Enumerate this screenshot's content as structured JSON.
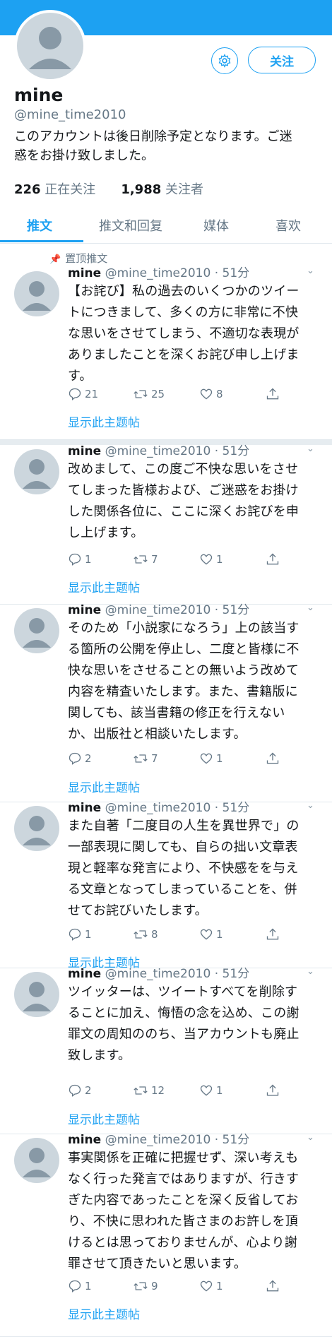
{
  "profile": {
    "name": "mine",
    "handle": "@mine_time2010",
    "bio_lines": [
      "このアカウントは後日削除予定となります。ご迷",
      "惑をお掛け致しました。"
    ],
    "following_count": "226",
    "following_label": "正在关注",
    "followers_count": "1,988",
    "followers_label": "关注者",
    "follow_button": "关注"
  },
  "tabs": [
    "推文",
    "推文和回复",
    "媒体",
    "喜欢"
  ],
  "pinned_label": "置顶推文",
  "tweets": [
    {
      "name": "mine",
      "handle": "@mine_time2010",
      "time": "· 51分",
      "lines": [
        "【お詫び】私の過去のいくつかのツイー",
        "トにつきまして、多くの方に非常に不快",
        "な思いをさせてしまう、不適切な表現が",
        "ありましたことを深くお詫び申し上げま",
        "す。"
      ],
      "replies": "21",
      "retweets": "25",
      "likes": "8",
      "show_thread": "显示此主题帖"
    },
    {
      "name": "mine",
      "handle": "@mine_time2010",
      "time": "· 51分",
      "lines": [
        "改めまして、この度ご不快な思いをさせ",
        "てしまった皆様および、ご迷惑をお掛け",
        "した関係各位に、ここに深くお詫びを申",
        "し上げます。"
      ],
      "replies": "1",
      "retweets": "7",
      "likes": "1",
      "show_thread": "显示此主题帖"
    },
    {
      "name": "mine",
      "handle": "@mine_time2010",
      "time": "· 51分",
      "lines": [
        "そのため「小説家になろう」上の該当す",
        "る箇所の公開を停止し、二度と皆様に不",
        "快な思いをさせることの無いよう改めて",
        "内容を精査いたします。また、書籍版に",
        "関しても、該当書籍の修正を行えない",
        "か、出版社と相談いたします。"
      ],
      "replies": "2",
      "retweets": "7",
      "likes": "1",
      "show_thread": "显示此主题帖"
    },
    {
      "name": "mine",
      "handle": "@mine_time2010",
      "time": "· 51分",
      "lines": [
        "また自著「二度目の人生を異世界で」の",
        "一部表現に関しても、自らの拙い文章表",
        "現と軽率な発言により、不快感をを与え",
        "る文章となってしまっていることを、併",
        "せてお詫びいたします。"
      ],
      "replies": "1",
      "retweets": "8",
      "likes": "1",
      "show_thread": "显示此主题帖"
    },
    {
      "name": "mine",
      "handle": "@mine_time2010",
      "time": "· 51分",
      "lines": [
        "ツイッターは、ツイートすべてを削除す",
        "ることに加え、悔悟の念を込め、この謝",
        "罪文の周知ののち、当アカウントも廃止",
        "致します。"
      ],
      "replies": "2",
      "retweets": "12",
      "likes": "1",
      "show_thread": "显示此主题帖"
    },
    {
      "name": "mine",
      "handle": "@mine_time2010",
      "time": "· 51分",
      "lines": [
        "事実関係を正確に把握せず、深い考えも",
        "なく行った発言ではありますが、行きす",
        "ぎた内容であったことを深く反省してお",
        "り、不快に思われた皆さまのお許しを頂",
        "けるとは思っておりませんが、心より謝",
        "罪させて頂きたいと思います。"
      ],
      "replies": "1",
      "retweets": "9",
      "likes": "1",
      "show_thread": "显示此主题帖"
    }
  ],
  "colors": {
    "accent": "#1da1f2",
    "text": "#14171a",
    "muted": "#657786",
    "avatar": "#ccd6dd"
  }
}
